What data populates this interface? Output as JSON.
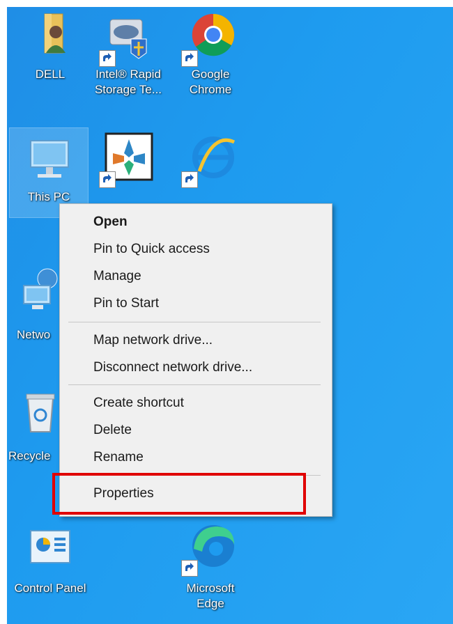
{
  "desktop": {
    "icons": [
      {
        "label": "DELL",
        "icon": "user-folder-icon"
      },
      {
        "label": "Intel® Rapid\nStorage Te...",
        "icon": "intel-rst-icon"
      },
      {
        "label": "Google\nChrome",
        "icon": "chrome-icon"
      },
      {
        "label": "This PC",
        "icon": "this-pc-icon"
      },
      {
        "label": "",
        "icon": "app-shortcut-icon"
      },
      {
        "label": "",
        "icon": "internet-explorer-icon"
      },
      {
        "label": "Netwo",
        "icon": "network-icon"
      },
      {
        "label": "Recycle",
        "icon": "recycle-bin-icon"
      },
      {
        "label": "Control Panel",
        "icon": "control-panel-icon"
      },
      {
        "label": "Microsoft\nEdge",
        "icon": "edge-icon"
      }
    ]
  },
  "context_menu": {
    "items": [
      {
        "label": "Open"
      },
      {
        "label": "Pin to Quick access"
      },
      {
        "label": "Manage"
      },
      {
        "label": "Pin to Start"
      },
      {
        "label": "Map network drive..."
      },
      {
        "label": "Disconnect network drive..."
      },
      {
        "label": "Create shortcut"
      },
      {
        "label": "Delete"
      },
      {
        "label": "Rename"
      },
      {
        "label": "Properties"
      }
    ]
  },
  "colors": {
    "desktop_bg": "#1e9bef",
    "highlight": "#e00000"
  }
}
